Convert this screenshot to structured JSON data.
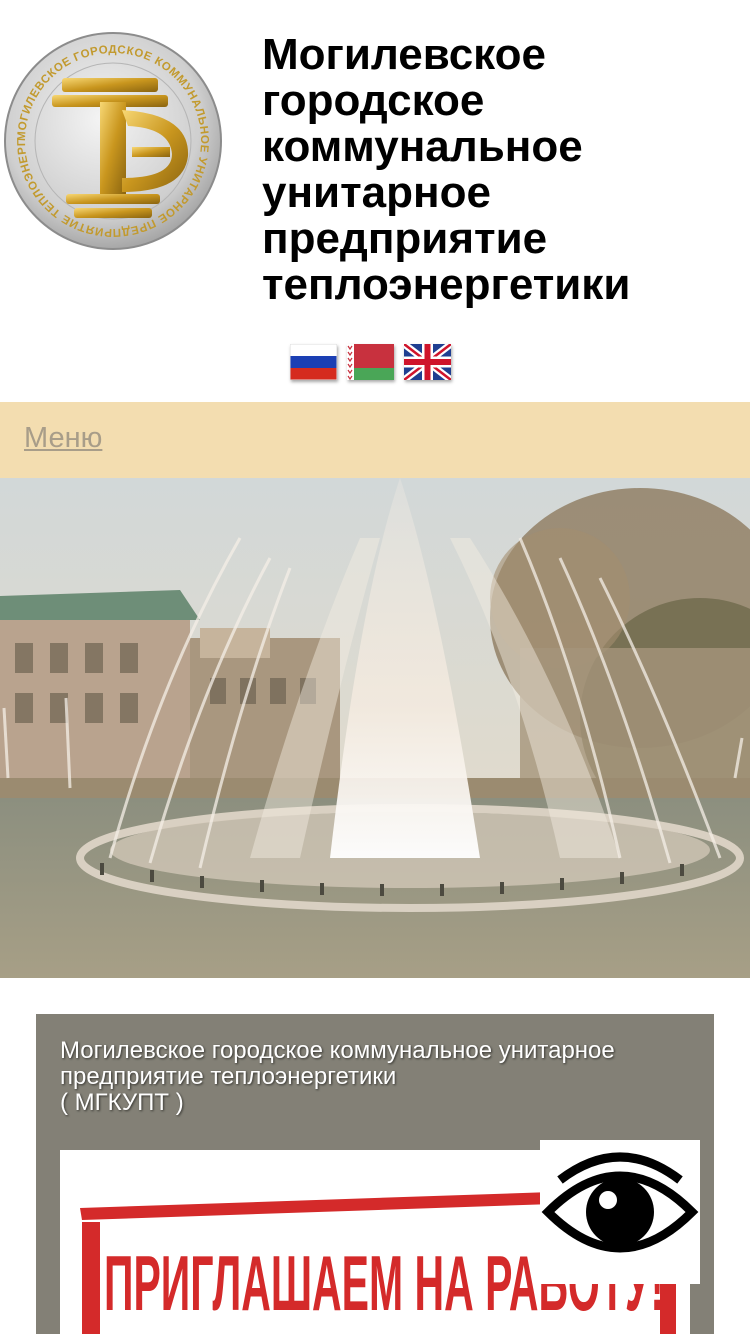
{
  "header": {
    "logo_text": "МОГИЛЕВСКОЕ ГОРОДСКОЕ КОММУНАЛЬНОЕ УНИТАРНОЕ ПРЕДПРИЯТИЕ ТЕПЛОЭНЕРГЕТИКИ",
    "logo_monogram": "ТЭ",
    "title_lines": [
      "Могилевское",
      "городское",
      "коммунальное",
      "унитарное",
      "предприятие",
      "теплоэнергетики"
    ]
  },
  "languages": [
    {
      "code": "ru",
      "icon": "russia-flag-icon"
    },
    {
      "code": "be",
      "icon": "belarus-flag-icon"
    },
    {
      "code": "en",
      "icon": "uk-flag-icon"
    }
  ],
  "menu": {
    "label": "Меню"
  },
  "content": {
    "intro_line1": "Могилевское городское коммунальное унитарное",
    "intro_line2": "предприятие теплоэнергетики",
    "intro_line3": "( МГКУПТ )",
    "promo_text": "ПРИГЛАШАЕМ НА РАБОТУ!"
  },
  "accessibility": {
    "icon": "eye-icon"
  },
  "colors": {
    "menu_bg": "#f3ddb0",
    "menu_link": "#a89d89",
    "panel_bg": "#838076",
    "promo_red": "#d42a2a"
  }
}
